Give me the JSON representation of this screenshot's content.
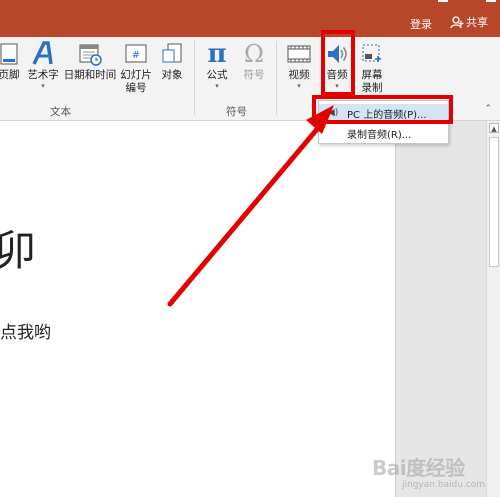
{
  "titlebar": {
    "login": "登录",
    "share": "共享",
    "accent": "#b7472a"
  },
  "ribbon": {
    "buttons": {
      "header_footer": "页脚",
      "wordart": "艺术字",
      "datetime": "日期和时间",
      "slide_number_1": "幻灯片",
      "slide_number_2": "编号",
      "object": "对象",
      "equation": "公式",
      "symbol": "符号",
      "video": "视频",
      "audio": "音频",
      "screen_record_1": "屏幕",
      "screen_record_2": "录制"
    },
    "groups": {
      "text": "文本",
      "symbols": "符号"
    }
  },
  "audio_menu": {
    "items": [
      {
        "label": "PC 上的音频(P)...",
        "icon": "speaker-icon"
      },
      {
        "label": "录制音频(R)...",
        "icon": ""
      }
    ]
  },
  "slide": {
    "title_fragment": "卯",
    "body_fragment": "点我哟"
  },
  "watermark": {
    "main": "Bai度经验",
    "sub": "jingyan.baidu.com"
  },
  "colors": {
    "highlight": "#e30000",
    "menu_hover": "#d5e4f4"
  }
}
